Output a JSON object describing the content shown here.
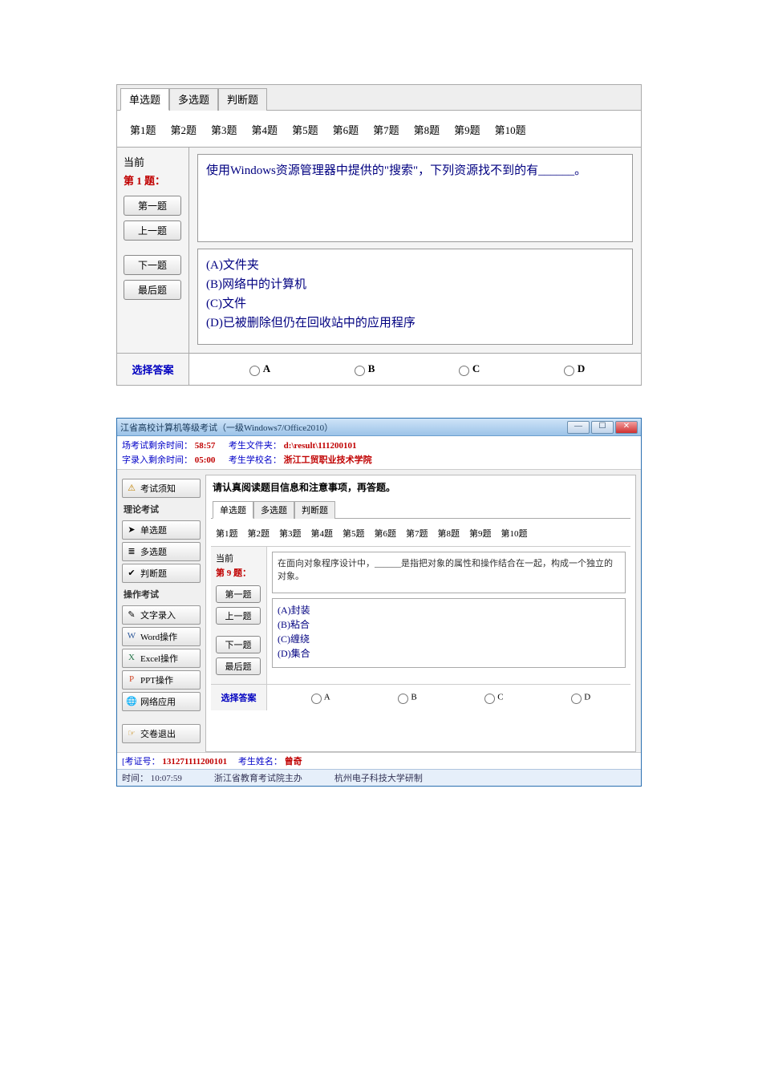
{
  "panel1": {
    "tabs": [
      "单选题",
      "多选题",
      "判断题"
    ],
    "activeTab": 0,
    "qnav": [
      "第1题",
      "第2题",
      "第3题",
      "第4题",
      "第5题",
      "第6题",
      "第7题",
      "第8题",
      "第9题",
      "第10题"
    ],
    "currentLabel": "当前",
    "currentQ": "第 1 题：",
    "navBtns": {
      "first": "第一题",
      "prev": "上一题",
      "next": "下一题",
      "last": "最后题"
    },
    "question": "使用Windows资源管理器中提供的\"搜索\"，下列资源找不到的有______。",
    "options": {
      "a": "(A)文件夹",
      "b": "(B)网络中的计算机",
      "c": "(C)文件",
      "d": "(D)已被删除但仍在回收站中的应用程序"
    },
    "answerLabel": "选择答案",
    "choices": [
      "A",
      "B",
      "C",
      "D"
    ]
  },
  "panel2": {
    "windowTitle": "江省高校计算机等级考试（一级Windows7/Office2010）",
    "winBtns": {
      "min": "—",
      "max": "☐",
      "close": "✕"
    },
    "info": {
      "examTimeLabel": "场考试剩余时间：",
      "examTime": "58:57",
      "fileLabel": "考生文件夹：",
      "fileVal": "d:\\result\\111200101",
      "typingTimeLabel": "字录入剩余时间：",
      "typingTime": "05:00",
      "schoolLabel": "考生学校名：",
      "schoolVal": "浙江工贸职业技术学院"
    },
    "leftnav": {
      "notice": "考试须知",
      "theoryHeader": "理论考试",
      "single": "单选题",
      "multi": "多选题",
      "judge": "判断题",
      "opHeader": "操作考试",
      "typing": "文字录入",
      "word": "Word操作",
      "excel": "Excel操作",
      "ppt": "PPT操作",
      "net": "网络应用",
      "submit": "交卷退出"
    },
    "instruction": "请认真阅读题目信息和注意事项，再答题。",
    "tabs": [
      "单选题",
      "多选题",
      "判断题"
    ],
    "activeTab": 0,
    "qnav": [
      "第1题",
      "第2题",
      "第3题",
      "第4题",
      "第5题",
      "第6题",
      "第7题",
      "第8题",
      "第9题",
      "第10题"
    ],
    "currentLabel": "当前",
    "currentQ": "第 9 题：",
    "navBtns": {
      "first": "第一题",
      "prev": "上一题",
      "next": "下一题",
      "last": "最后题"
    },
    "question": "在面向对象程序设计中，______是指把对象的属性和操作结合在一起，构成一个独立的对象。",
    "options": {
      "a": "(A)封装",
      "b": "(B)粘合",
      "c": "(C)缠绕",
      "d": "(D)集合"
    },
    "answerLabel": "选择答案",
    "choices": [
      "A",
      "B",
      "C",
      "D"
    ],
    "footer": {
      "examIdLabel": "[考证号：",
      "examId": "131271111200101",
      "nameLabel": "考生姓名：",
      "nameVal": "曾奇"
    },
    "status": {
      "timeLabel": "时间：",
      "time": "10:07:59",
      "org1": "浙江省教育考试院主办",
      "org2": "杭州电子科技大学研制"
    }
  }
}
